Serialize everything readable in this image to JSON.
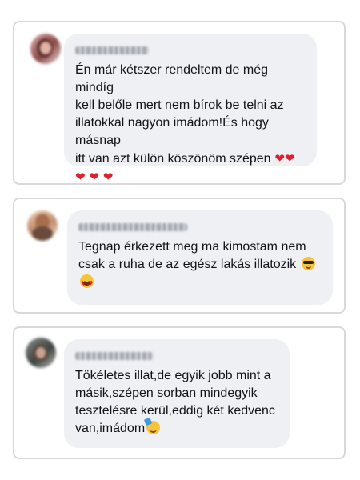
{
  "colors": {
    "card_border": "#d9d9d9",
    "bubble_bg": "#eef0f3",
    "text": "#111317",
    "heart": "#e0202e"
  },
  "comments": [
    {
      "author": "Erzsébet Kiss",
      "author_blurred": true,
      "text": "Én már kétszer rendeltem de még mindíg\nkell belőle mert nem bírok be telni az\nillatokkal nagyon imádom!És hogy másnap\nitt van azt külön köszönöm szépen",
      "emojis": [
        "heart",
        "heart",
        "heart",
        "heart",
        "heart"
      ]
    },
    {
      "author": "Mária Schildberg",
      "author_blurred": true,
      "text": "Tegnap érkezett meg ma kimostam nem\ncsak a ruha de az egész lakás illatozik",
      "emojis": [
        "smiling-face-with-sunglasses",
        "smiling-face-with-heart-eyes"
      ]
    },
    {
      "author": "Dominika Szilágyi",
      "author_blurred": true,
      "text": "Tökéletes illat,de egyik jobb mint a\nmásik,szépen sorban mindegyik\ntesztelésre kerül,eddig két kedvenc\nvan,imádom",
      "emojis": [
        "smiling-face-with-hearts"
      ]
    }
  ]
}
